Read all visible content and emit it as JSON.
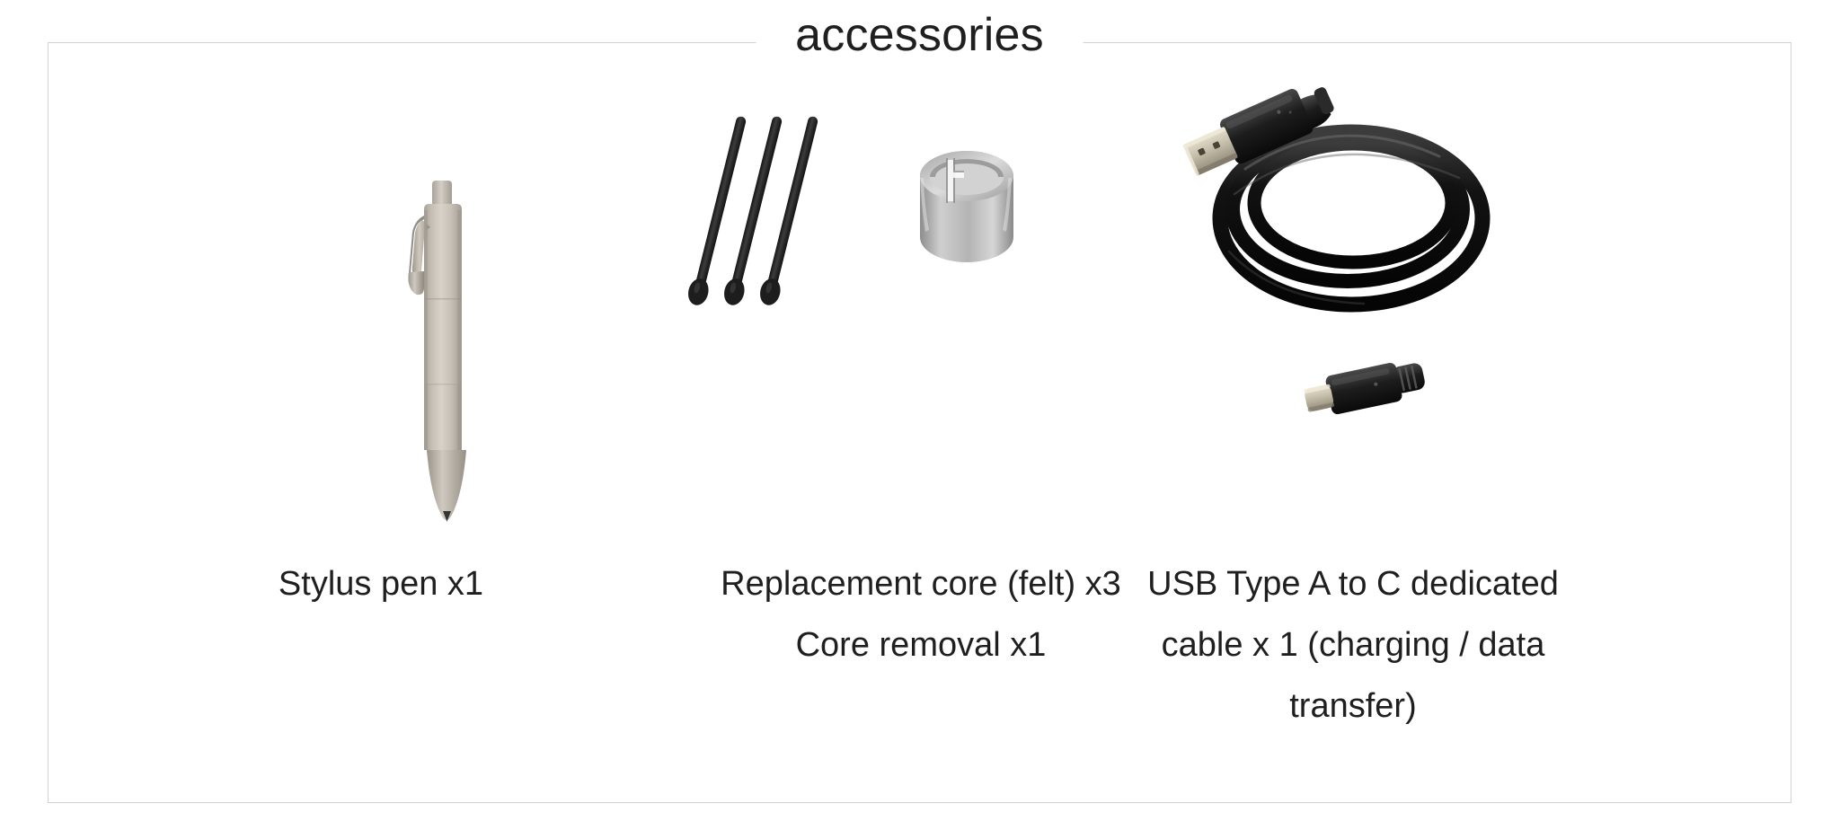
{
  "panel": {
    "legend": "accessories",
    "border_color": "#d2d2d2",
    "background": "#ffffff",
    "text_color": "#1f1f1f"
  },
  "items": [
    {
      "id": "stylus-pen",
      "icon": "stylus-pen-image",
      "caption": "Stylus pen x1",
      "colors": {
        "body": "#b8b2a8",
        "body_light": "#d6d1c8",
        "body_dark": "#9a948a",
        "tip": "#3a3a3a",
        "clip": "#8d877d"
      }
    },
    {
      "id": "replacement-core",
      "icon": "replacement-core-and-removal-tool-image",
      "caption": "Replacement core (felt) x3\nCore removal x1",
      "colors": {
        "core": "#2b2b2b",
        "core_tip": "#1a1a1a",
        "ring": "#b9b9b9",
        "ring_dark": "#8f8f8f",
        "ring_light": "#dcdcdc"
      }
    },
    {
      "id": "usb-cable",
      "icon": "usb-type-a-to-c-cable-image",
      "caption": "USB Type A to C dedicated cable x 1 (charging / data transfer)",
      "colors": {
        "cable": "#1b1b1b",
        "cable_highlight": "#4a4a4a",
        "connector": "#2a2a2a",
        "metal": "#c9c4b4",
        "metal_dark": "#9a9384"
      }
    }
  ]
}
